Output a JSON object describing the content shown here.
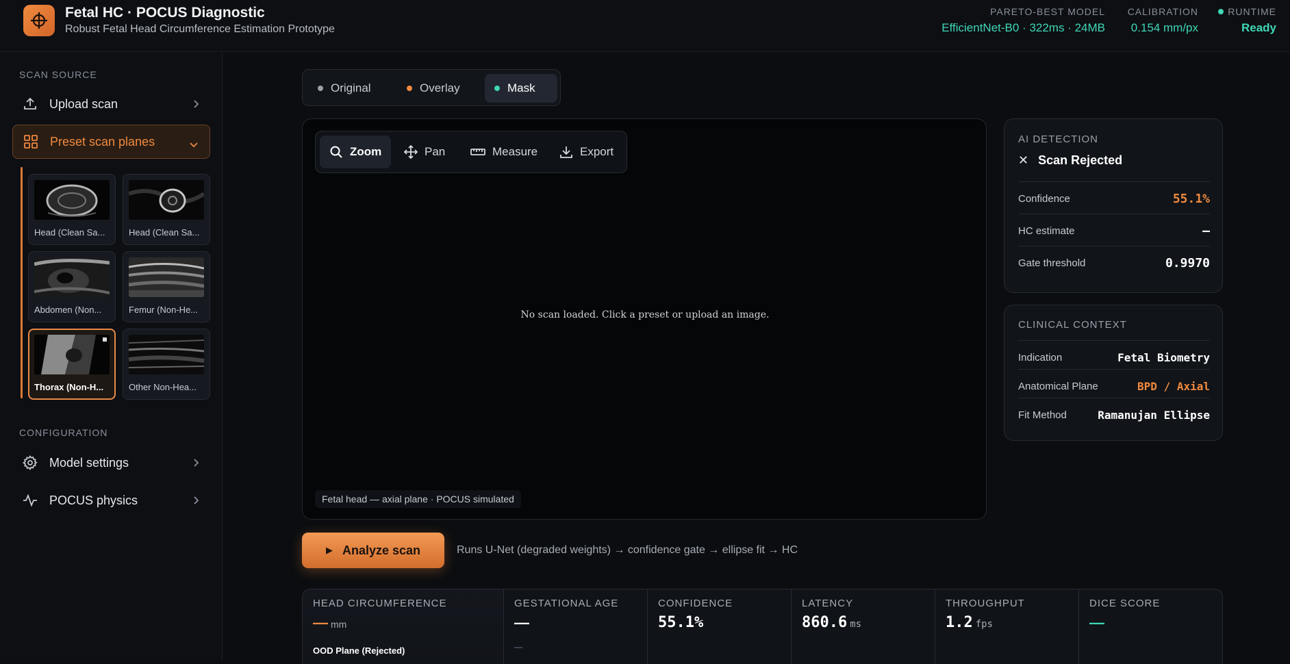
{
  "header": {
    "title": "Fetal HC · POCUS Diagnostic",
    "subtitle": "Robust Fetal Head Circumference Estimation Prototype",
    "model_label": "PARETO-BEST MODEL",
    "model_value": "EfficientNet-B0 · 322ms · 24MB",
    "calibration_label": "CALIBRATION",
    "calibration_value": "0.154 mm/px",
    "runtime_label": "RUNTIME",
    "runtime_value": "Ready",
    "accent_color": "#3fd7b5"
  },
  "sidebar": {
    "scan_source_label": "SCAN SOURCE",
    "upload_label": "Upload scan",
    "presets_label": "Preset scan planes",
    "presets": [
      {
        "label": "Head (Clean Sa...",
        "icon": "fetal-head-ultrasound"
      },
      {
        "label": "Head (Clean Sa...",
        "icon": "fetal-head-ultrasound"
      },
      {
        "label": "Abdomen (Non...",
        "icon": "abdomen-ultrasound"
      },
      {
        "label": "Femur (Non-He...",
        "icon": "femur-ultrasound"
      },
      {
        "label": "Thorax (Non-H...",
        "icon": "thorax-ultrasound"
      },
      {
        "label": "Other Non-Hea...",
        "icon": "other-ultrasound"
      }
    ],
    "configuration_label": "CONFIGURATION",
    "model_settings_label": "Model settings",
    "physics_label": "POCUS physics"
  },
  "view_tabs": {
    "original": "Original",
    "overlay": "Overlay",
    "mask": "Mask",
    "active": "Mask"
  },
  "toolbar": {
    "zoom": "Zoom",
    "pan": "Pan",
    "measure": "Measure",
    "export": "Export"
  },
  "canvas": {
    "empty_message": "No scan loaded. Click a preset or upload an image.",
    "caption": "Fetal head — axial plane · POCUS simulated"
  },
  "analyze": {
    "button_label": "Analyze scan",
    "pipeline": "Runs U-Net (degraded weights) → confidence gate → ellipse fit → HC"
  },
  "ai_detection": {
    "label": "AI DETECTION",
    "status": "Scan Rejected",
    "confidence_label": "Confidence",
    "confidence_value": "55.1%",
    "hc_label": "HC estimate",
    "hc_value": "—",
    "gate_label": "Gate threshold",
    "gate_value": "0.9970"
  },
  "clinical_context": {
    "label": "CLINICAL CONTEXT",
    "indication_label": "Indication",
    "indication_value": "Fetal Biometry",
    "plane_label": "Anatomical Plane",
    "plane_value": "BPD / Axial",
    "fit_label": "Fit Method",
    "fit_value": "Ramanujan Ellipse"
  },
  "metrics": {
    "hc_label": "HEAD CIRCUMFERENCE",
    "hc_value": "—",
    "hc_unit": "mm",
    "hc_status": "OOD Plane (Rejected)",
    "ga_label": "GESTATIONAL AGE",
    "ga_value": "—",
    "conf_label": "CONFIDENCE",
    "conf_value": "55.1%",
    "latency_label": "LATENCY",
    "latency_value": "860.6",
    "latency_unit": "ms",
    "throughput_label": "THROUGHPUT",
    "throughput_value": "1.2",
    "throughput_unit": "fps",
    "dice_label": "DICE SCORE",
    "dice_value": "—"
  },
  "colors": {
    "accent_orange": "#f0893f",
    "accent_teal": "#3fd7b5",
    "original_dot": "#9aa1ab"
  }
}
